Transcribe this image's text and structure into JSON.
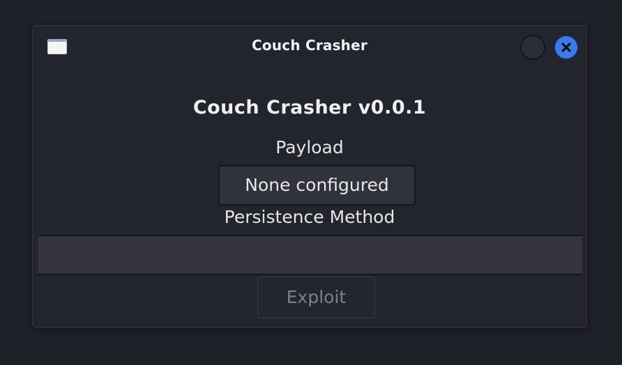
{
  "window": {
    "title": "Couch Crasher",
    "app_icon": "window-icon",
    "controls": {
      "minimize_icon": "circle-icon",
      "close_icon": "close-icon"
    }
  },
  "main": {
    "heading": "Couch Crasher v0.0.1",
    "payload_label": "Payload",
    "payload_button": "None configured",
    "persistence_label": "Persistence Method",
    "persistence_value": "",
    "exploit_button": "Exploit"
  },
  "colors": {
    "background": "#1f2129",
    "window": "#23252e",
    "close_accent": "#3f78e8",
    "disabled_text": "#7e8088"
  }
}
